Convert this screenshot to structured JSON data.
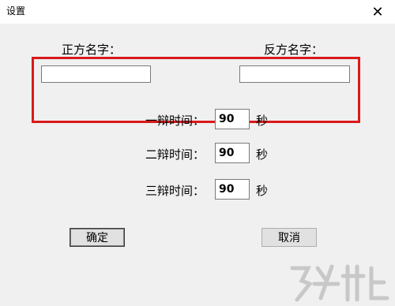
{
  "window": {
    "title": "设置",
    "close_glyph": "✕"
  },
  "affirmative": {
    "label": "正方名字：",
    "value": ""
  },
  "negative": {
    "label": "反方名字：",
    "value": ""
  },
  "rounds": [
    {
      "label": "一辩时间：",
      "value": "90",
      "unit": "秒"
    },
    {
      "label": "二辩时间：",
      "value": "90",
      "unit": "秒"
    },
    {
      "label": "三辩时间：",
      "value": "90",
      "unit": "秒"
    }
  ],
  "buttons": {
    "ok": "确定",
    "cancel": "取消"
  },
  "colors": {
    "highlight": "#d9191c"
  }
}
